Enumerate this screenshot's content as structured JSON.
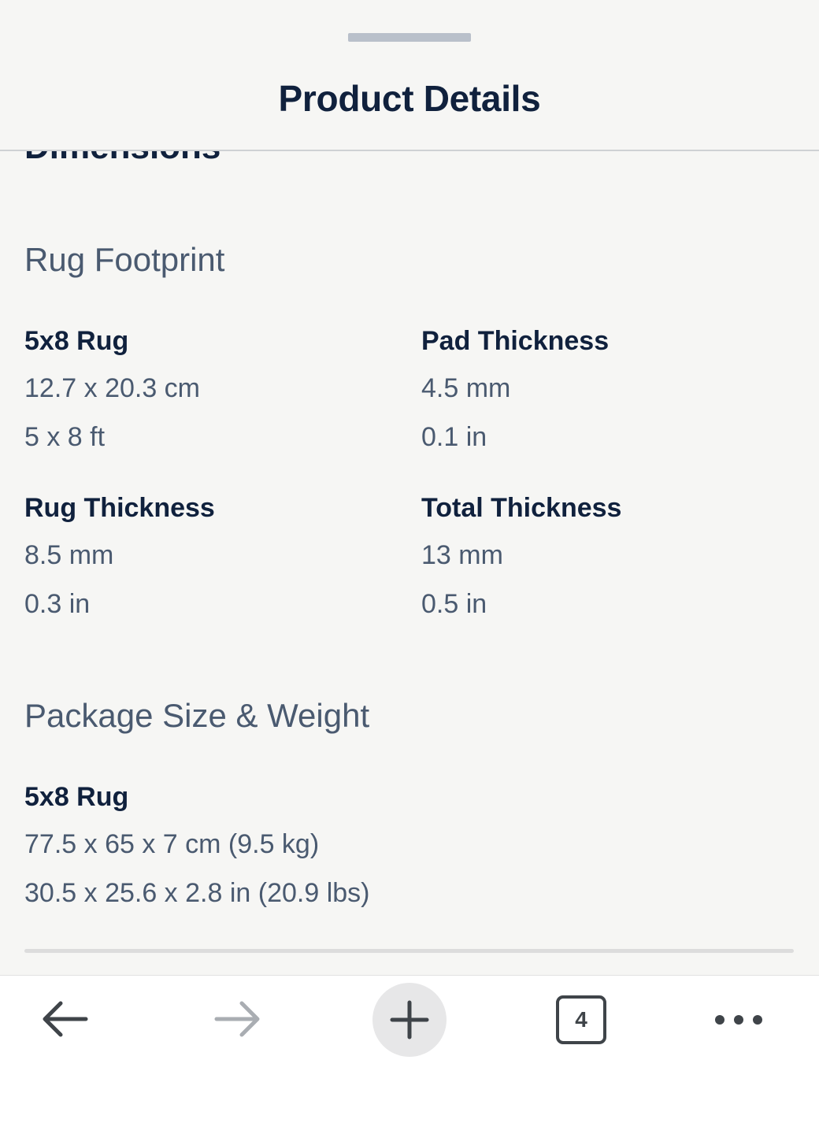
{
  "sheet": {
    "title": "Product Details"
  },
  "content": {
    "clipped_heading": "Dimensions",
    "rug_footprint": {
      "heading": "Rug Footprint",
      "items": [
        {
          "label": "5x8 Rug",
          "metric": "12.7 x 20.3 cm",
          "imperial": "5 x 8 ft"
        },
        {
          "label": "Pad Thickness",
          "metric": "4.5 mm",
          "imperial": "0.1 in"
        },
        {
          "label": "Rug Thickness",
          "metric": "8.5 mm",
          "imperial": "0.3 in"
        },
        {
          "label": "Total Thickness",
          "metric": "13 mm",
          "imperial": "0.5 in"
        }
      ]
    },
    "package": {
      "heading": "Package Size & Weight",
      "items": [
        {
          "label": "5x8 Rug",
          "metric": "77.5 x 65 x 7 cm (9.5 kg)",
          "imperial": "30.5 x 25.6 x 2.8 in (20.9 lbs)"
        }
      ]
    }
  },
  "toolbar": {
    "back_icon": "arrow-left-icon",
    "forward_icon": "arrow-right-icon",
    "new_tab_icon": "plus-icon",
    "tab_count": "4",
    "more_icon": "more-horizontal-icon"
  },
  "colors": {
    "background": "#f6f6f4",
    "title_text": "#10213d",
    "value_text": "#4a5a70",
    "toolbar_bg": "#ffffff"
  }
}
